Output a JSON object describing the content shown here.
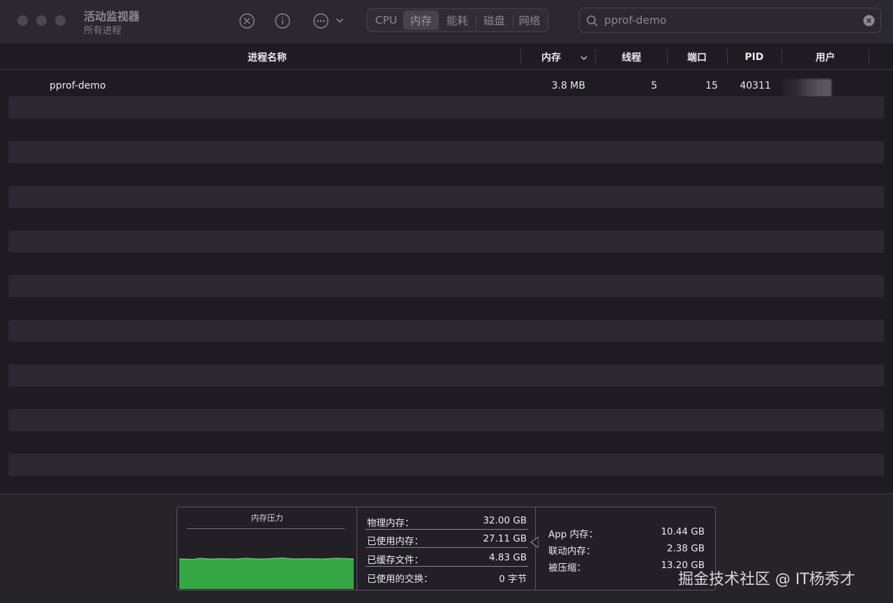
{
  "window": {
    "title": "活动监视器",
    "subtitle": "所有进程"
  },
  "toolbar": {
    "stop_icon": "stop-process-icon",
    "info_icon": "info-icon",
    "more_icon": "more-actions-icon",
    "tabs": [
      {
        "label": "CPU",
        "active": false
      },
      {
        "label": "内存",
        "active": true
      },
      {
        "label": "能耗",
        "active": false
      },
      {
        "label": "磁盘",
        "active": false
      },
      {
        "label": "网络",
        "active": false
      }
    ]
  },
  "search": {
    "value": "pprof-demo"
  },
  "table": {
    "columns": {
      "name": "进程名称",
      "memory": "内存",
      "threads": "线程",
      "ports": "端口",
      "pid": "PID",
      "user": "用户"
    },
    "sort_column": "memory",
    "sort_direction": "descending",
    "rows": [
      {
        "name": "pprof-demo",
        "memory": "3.8 MB",
        "threads": "5",
        "ports": "15",
        "pid": "40311",
        "user_redacted": true
      }
    ]
  },
  "memory_panel": {
    "pressure_title": "内存压力",
    "pressure_color": "#34a744",
    "stats_left": [
      {
        "label": "物理内存：",
        "value": "32.00 GB"
      },
      {
        "label": "已使用内存：",
        "value": "27.11 GB"
      },
      {
        "label": "已缓存文件：",
        "value": "4.83 GB"
      },
      {
        "label": "已使用的交换：",
        "value": "0 字节"
      }
    ],
    "stats_right": [
      {
        "label": "App 内存：",
        "value": "10.44 GB"
      },
      {
        "label": "联动内存：",
        "value": "2.38 GB"
      },
      {
        "label": "被压缩：",
        "value": "13.20 GB"
      }
    ]
  },
  "watermark": "掘金技术社区 @ IT杨秀才"
}
